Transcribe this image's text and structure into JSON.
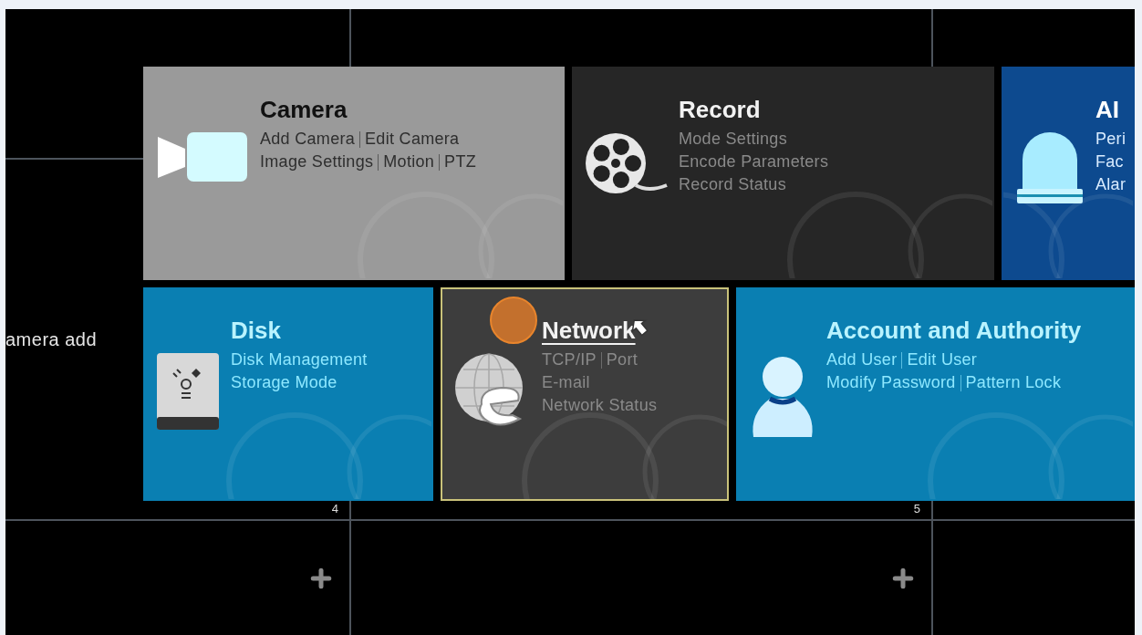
{
  "channels": [
    {
      "label": "amera add",
      "number": "4"
    },
    {
      "number": "5"
    }
  ],
  "menu_tiles": [
    [
      {
        "title": "Camera",
        "kind": "light",
        "color": "#9a9a9a",
        "selected": false,
        "lines": [
          [
            "Add Camera",
            "Edit Camera"
          ],
          [
            "Image Settings",
            "Motion",
            "PTZ"
          ]
        ]
      },
      {
        "title": "Record",
        "kind": "dark",
        "color": "#262626",
        "selected": false,
        "lines": [
          [
            "Mode Settings"
          ],
          [
            "Encode Parameters"
          ],
          [
            "Record Status"
          ]
        ]
      },
      {
        "title": "AI",
        "kind": "white",
        "color": "#0d4a8f",
        "selected": false,
        "lines": [
          [
            "Peri"
          ],
          [
            "Fac"
          ],
          [
            "Alar"
          ]
        ]
      }
    ],
    [
      {
        "title": "Disk",
        "kind": "blue",
        "color": "#0a7fb2",
        "selected": false,
        "lines": [
          [
            "Disk Management"
          ],
          [
            "Storage Mode"
          ]
        ]
      },
      {
        "title": "Network",
        "kind": "dark",
        "color": "#3d3d3d",
        "selected": true,
        "lines": [
          [
            "TCP/IP",
            "Port"
          ],
          [
            "E-mail"
          ],
          [
            "Network Status"
          ]
        ]
      },
      {
        "title": "Account and Authority",
        "kind": "blue",
        "color": "#0a7fb2",
        "selected": false,
        "lines": [
          [
            "Add User",
            "Edit User"
          ],
          [
            "Modify Password",
            "Pattern Lock"
          ]
        ]
      }
    ]
  ]
}
